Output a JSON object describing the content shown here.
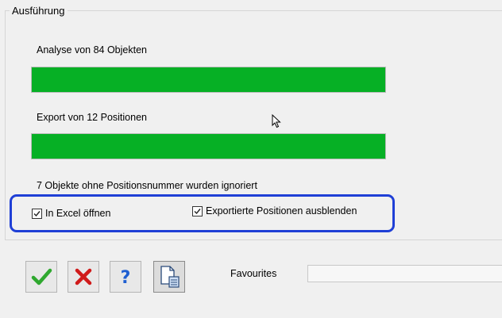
{
  "group": {
    "title": "Ausführung"
  },
  "analysis": {
    "label": "Analyse von 84 Objekten",
    "progress_percent": 100
  },
  "export": {
    "label": "Export von 12 Positionen",
    "progress_percent": 100
  },
  "status": {
    "ignored_text": "7 Objekte ohne Positionsnummer wurden ignoriert"
  },
  "options": {
    "open_excel": {
      "label": "In Excel öffnen",
      "checked": true
    },
    "hide_exported": {
      "label": "Exportierte Positionen ausblenden",
      "checked": true
    }
  },
  "toolbar": {
    "buttons": [
      {
        "icon": "green-checkmark-icon"
      },
      {
        "icon": "red-x-icon"
      },
      {
        "icon": "blue-question-icon"
      },
      {
        "icon": "document-export-icon"
      }
    ]
  },
  "favourites": {
    "label": "Favourites",
    "value": ""
  },
  "colors": {
    "progress_fill": "#06b025",
    "highlight_border": "#1f3fd6"
  }
}
